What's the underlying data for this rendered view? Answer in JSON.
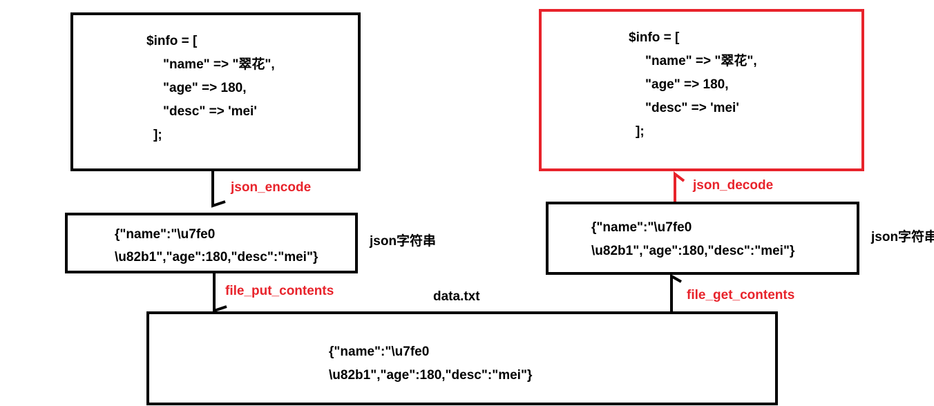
{
  "source_php_box": {
    "lines": [
      "$info = [",
      "\"name\" => \"翠花\",",
      "\"age\" => 180,",
      "\"desc\" => 'mei'",
      "];"
    ]
  },
  "decoded_php_box": {
    "lines": [
      "$info = [",
      "\"name\" => \"翠花\",",
      "\"age\" => 180,",
      "\"desc\" => 'mei'",
      "];"
    ]
  },
  "json_string_left": {
    "lines": [
      "{\"name\":\"\\u7fe0",
      "\\u82b1\",\"age\":180,\"desc\":\"mei\"}"
    ],
    "caption": "json字符串"
  },
  "json_string_right": {
    "lines": [
      "{\"name\":\"\\u7fe0",
      "\\u82b1\",\"age\":180,\"desc\":\"mei\"}"
    ],
    "caption": "json字符串"
  },
  "file_box": {
    "title": "data.txt",
    "lines": [
      "{\"name\":\"\\u7fe0",
      "\\u82b1\",\"age\":180,\"desc\":\"mei\"}"
    ]
  },
  "connectors": {
    "encode": "json_encode",
    "put": "file_put_contents",
    "get": "file_get_contents",
    "decode": "json_decode"
  },
  "colors": {
    "accent": "#e8232b",
    "stroke": "#000000"
  }
}
